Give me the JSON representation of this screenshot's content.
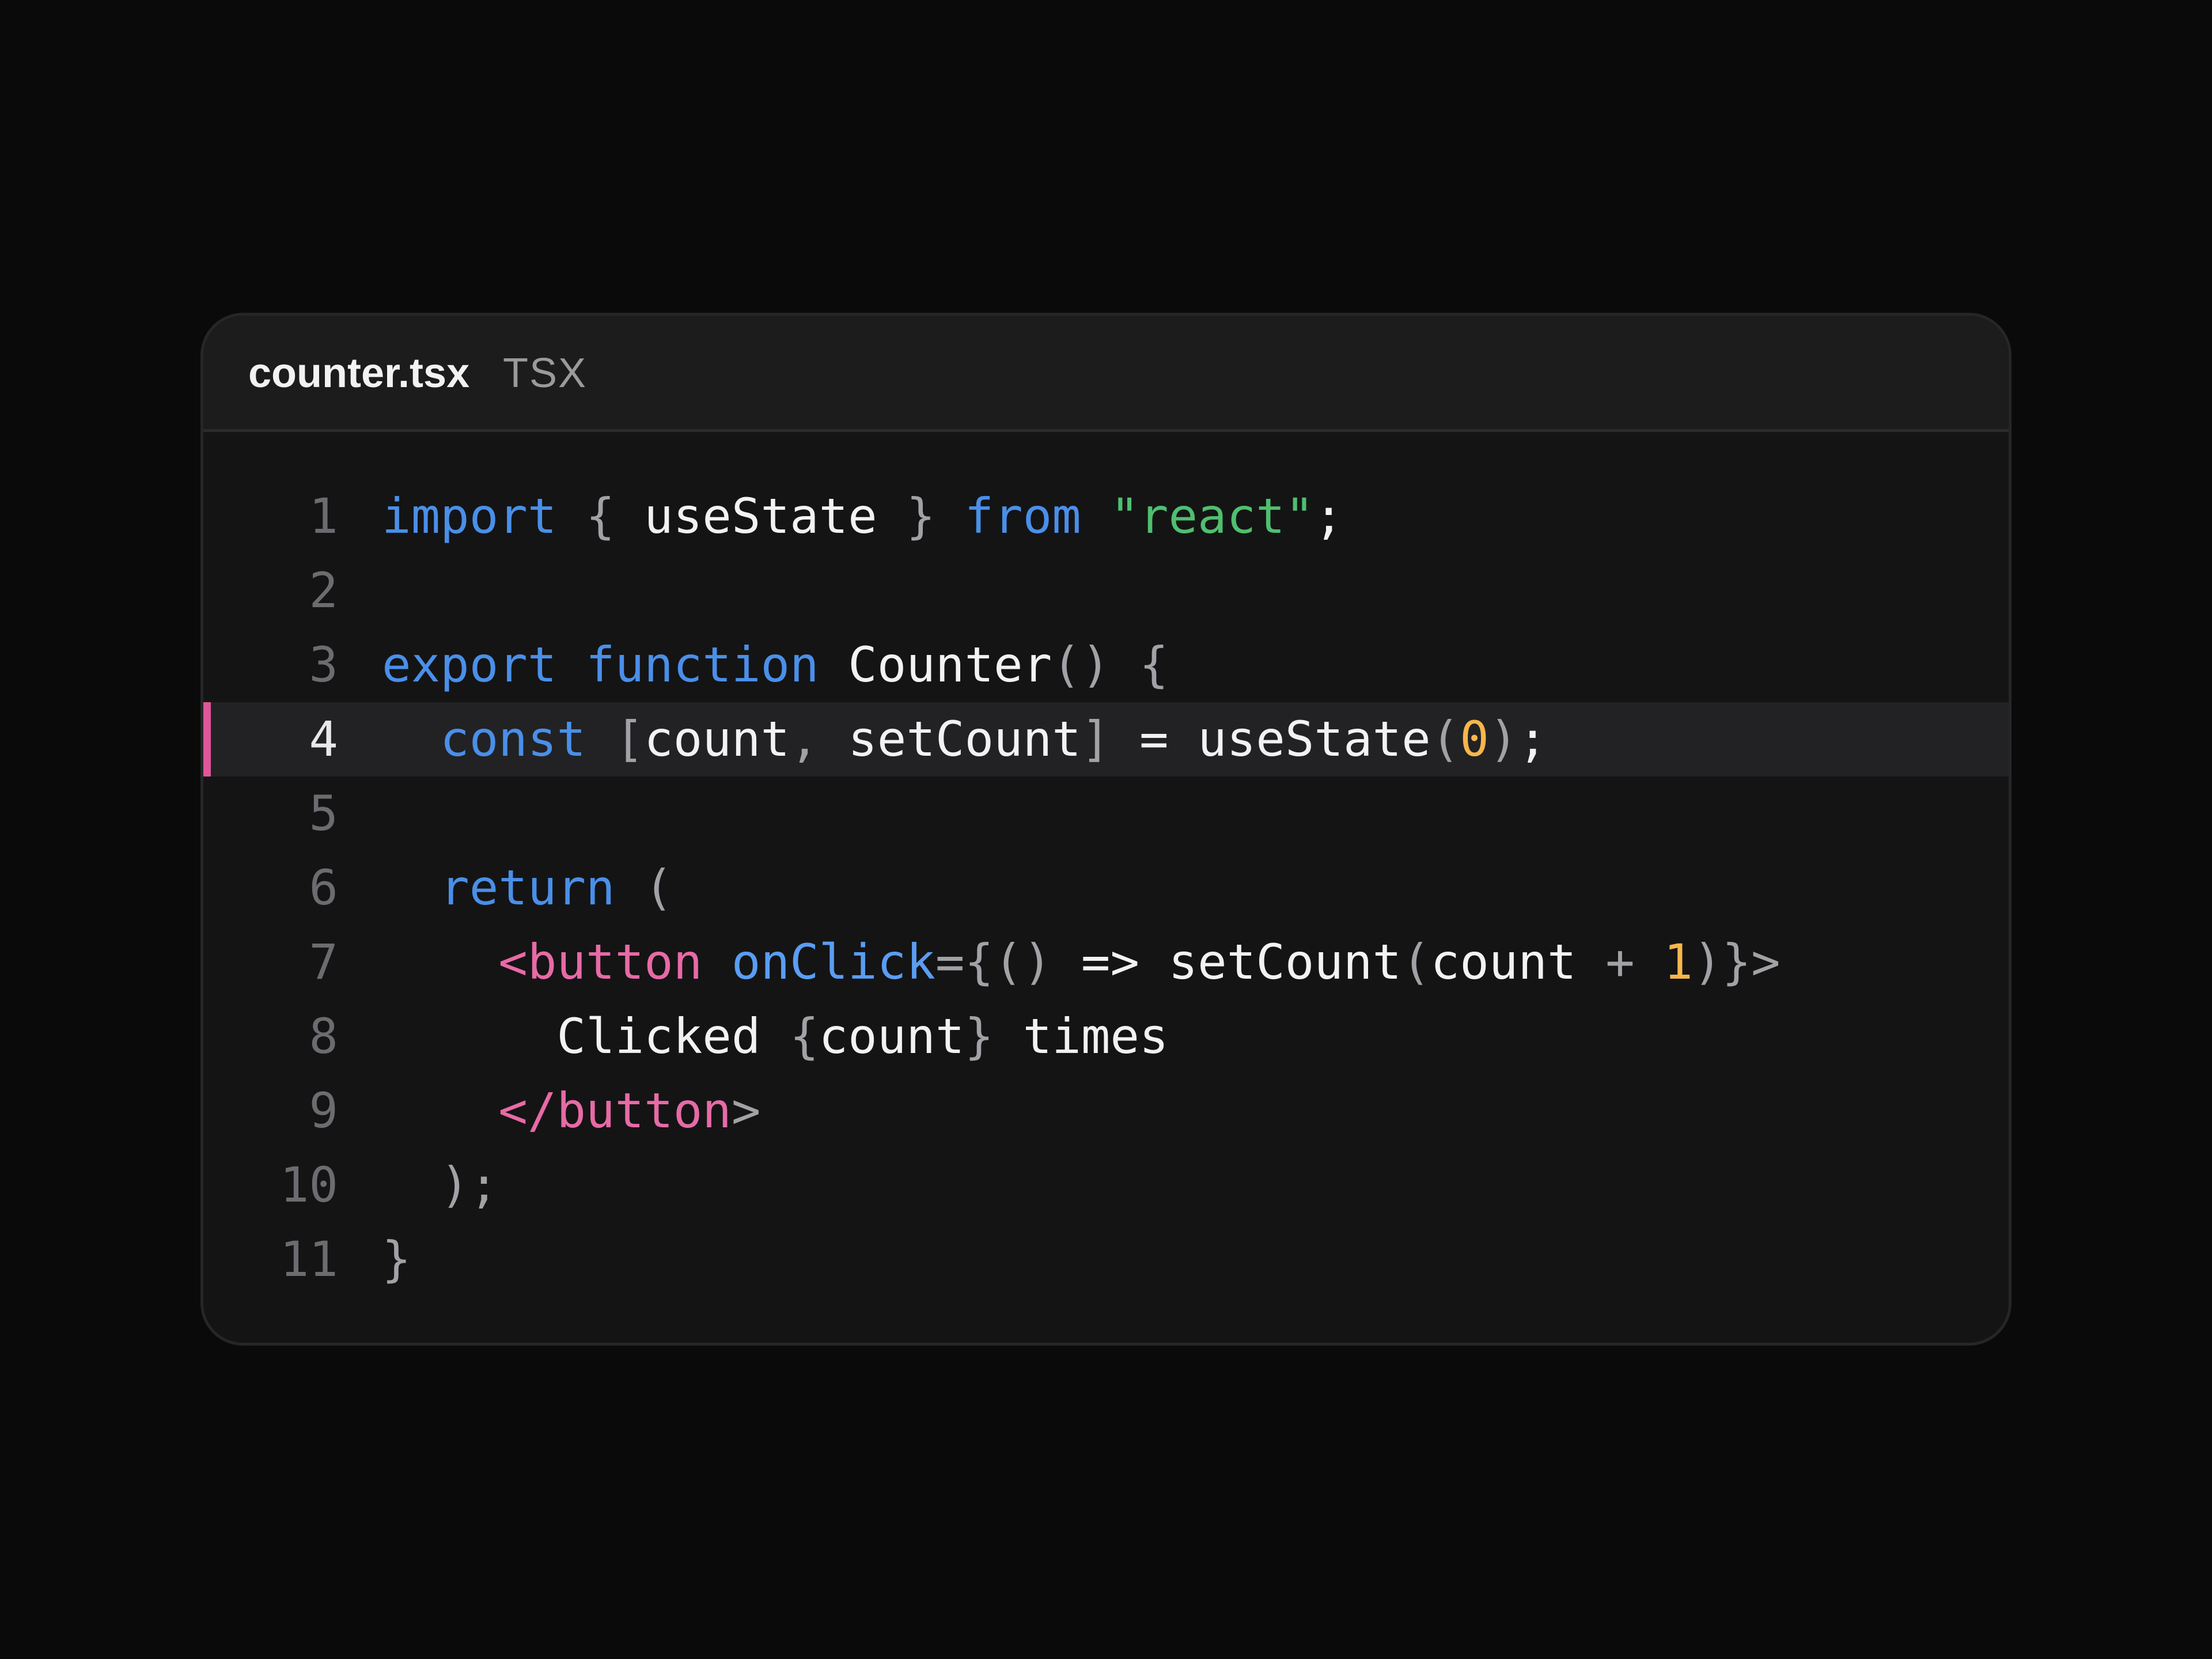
{
  "header": {
    "filename": "counter.tsx",
    "language": "TSX",
    "copy_icon": "copy-icon"
  },
  "editor": {
    "highlighted_line": 4,
    "colors": {
      "keyword": "#4a8fe8",
      "string": "#4fbf6e",
      "number": "#f6b64c",
      "jsx_tag": "#e76aa6",
      "highlight_bar": "#e0569a"
    },
    "lines": [
      {
        "n": "1",
        "tokens": [
          [
            "kw",
            "import"
          ],
          [
            "pn",
            " { "
          ],
          [
            "id",
            "useState"
          ],
          [
            "pn",
            " } "
          ],
          [
            "kw",
            "from"
          ],
          [
            "id",
            " "
          ],
          [
            "str",
            "\"react\""
          ],
          [
            "id",
            ";"
          ]
        ]
      },
      {
        "n": "2",
        "tokens": []
      },
      {
        "n": "3",
        "tokens": [
          [
            "kw",
            "export"
          ],
          [
            "id",
            " "
          ],
          [
            "kw",
            "function"
          ],
          [
            "id",
            " Counter"
          ],
          [
            "pn",
            "() {"
          ]
        ]
      },
      {
        "n": "4",
        "tokens": [
          [
            "id",
            "  "
          ],
          [
            "kw",
            "const"
          ],
          [
            "pn",
            " ["
          ],
          [
            "id",
            "count"
          ],
          [
            "pn",
            ", "
          ],
          [
            "id",
            "setCount"
          ],
          [
            "pn",
            "] "
          ],
          [
            "id",
            "= useState"
          ],
          [
            "pn",
            "("
          ],
          [
            "num",
            "0"
          ],
          [
            "pn",
            ")"
          ],
          [
            "id",
            ";"
          ]
        ]
      },
      {
        "n": "5",
        "tokens": []
      },
      {
        "n": "6",
        "tokens": [
          [
            "id",
            "  "
          ],
          [
            "kw",
            "return"
          ],
          [
            "pn",
            " ("
          ]
        ]
      },
      {
        "n": "7",
        "tokens": [
          [
            "id",
            "    "
          ],
          [
            "tag",
            "<button"
          ],
          [
            "id",
            " "
          ],
          [
            "attr",
            "onClick"
          ],
          [
            "pn",
            "={() "
          ],
          [
            "id",
            "=> setCount"
          ],
          [
            "pn",
            "("
          ],
          [
            "id",
            "count "
          ],
          [
            "pn",
            "+ "
          ],
          [
            "num",
            "1"
          ],
          [
            "pn",
            ")}>"
          ]
        ]
      },
      {
        "n": "8",
        "tokens": [
          [
            "id",
            "      Clicked "
          ],
          [
            "pn",
            "{"
          ],
          [
            "id",
            "count"
          ],
          [
            "pn",
            "}"
          ],
          [
            "id",
            " times"
          ]
        ]
      },
      {
        "n": "9",
        "tokens": [
          [
            "id",
            "    "
          ],
          [
            "tag",
            "</button"
          ],
          [
            "pn",
            ">"
          ]
        ]
      },
      {
        "n": "10",
        "tokens": [
          [
            "pn",
            "  );"
          ]
        ]
      },
      {
        "n": "11",
        "tokens": [
          [
            "pn",
            "}"
          ]
        ]
      }
    ]
  }
}
